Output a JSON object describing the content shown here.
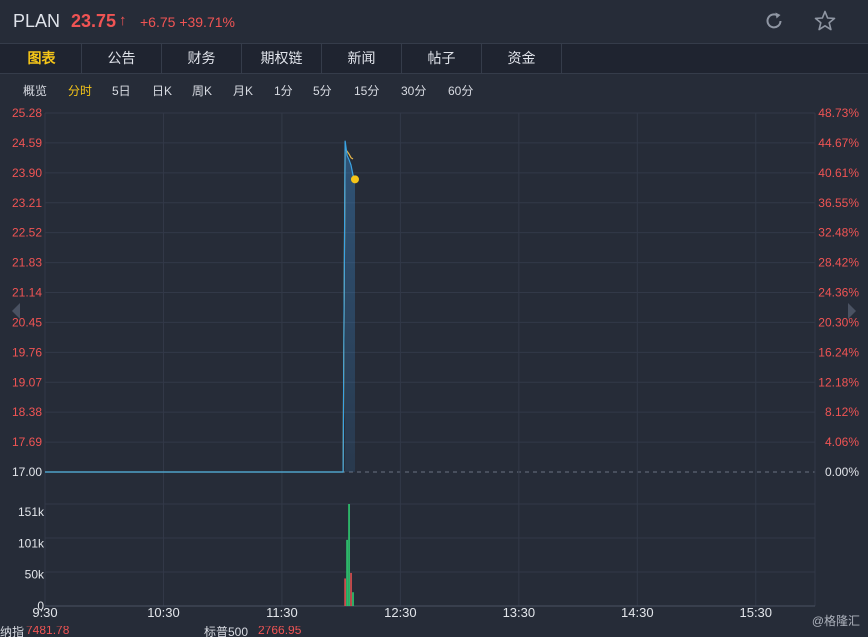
{
  "header": {
    "ticker": "PLAN",
    "price": "23.75",
    "price_arrow": "↑",
    "change": "+6.75 +39.71%",
    "refresh_icon": "refresh-icon",
    "star_icon": "star-icon"
  },
  "tabs": [
    {
      "label": "图表",
      "active": true
    },
    {
      "label": "公告"
    },
    {
      "label": "财务"
    },
    {
      "label": "期权链"
    },
    {
      "label": "新闻"
    },
    {
      "label": "帖子"
    },
    {
      "label": "资金"
    }
  ],
  "periods": [
    {
      "label": "概览"
    },
    {
      "label": "分时",
      "active": true
    },
    {
      "label": "5日"
    },
    {
      "label": "日K"
    },
    {
      "label": "周K"
    },
    {
      "label": "月K"
    },
    {
      "label": "1分"
    },
    {
      "label": "5分"
    },
    {
      "label": "15分"
    },
    {
      "label": "30分"
    },
    {
      "label": "60分"
    }
  ],
  "chart_data": {
    "type": "line",
    "base_price": 17.0,
    "price_ticks": [
      "25.28",
      "24.59",
      "23.90",
      "23.21",
      "22.52",
      "21.83",
      "21.14",
      "20.45",
      "19.76",
      "19.07",
      "18.38",
      "17.69",
      "17.00"
    ],
    "pct_ticks": [
      "48.73%",
      "44.67%",
      "40.61%",
      "36.55%",
      "32.48%",
      "28.42%",
      "24.36%",
      "20.30%",
      "16.24%",
      "12.18%",
      "8.12%",
      "4.06%",
      "0.00%"
    ],
    "ylim": [
      17.0,
      25.28
    ],
    "time_ticks": [
      "9:30",
      "10:30",
      "11:30",
      "12:30",
      "13:30",
      "14:30",
      "15:30"
    ],
    "xlim_minutes": [
      0,
      390
    ],
    "price_series": {
      "color": "#3aa3e3",
      "points": [
        [
          0,
          17.0
        ],
        [
          151,
          17.0
        ],
        [
          152,
          24.64
        ],
        [
          153,
          24.3
        ],
        [
          154,
          24.2
        ],
        [
          155,
          24.08
        ],
        [
          156,
          23.85
        ],
        [
          157,
          23.75
        ]
      ]
    },
    "avg_series": {
      "color": "#e8b84a",
      "points": [
        [
          0,
          17.0
        ],
        [
          151,
          17.0
        ],
        [
          152,
          24.45
        ],
        [
          153,
          24.4
        ],
        [
          154,
          24.33
        ],
        [
          155,
          24.25
        ],
        [
          156,
          24.22
        ]
      ]
    },
    "last_point": {
      "minute": 157,
      "price": 23.75,
      "color": "#f5c518"
    },
    "volume": {
      "ticks": [
        "151k",
        "101k",
        "50k",
        "0"
      ],
      "ylim": [
        0,
        185000
      ],
      "bars": [
        {
          "minute": 152,
          "value": 50000,
          "dir": "down"
        },
        {
          "minute": 153,
          "value": 120000,
          "dir": "up"
        },
        {
          "minute": 154,
          "value": 185000,
          "dir": "up"
        },
        {
          "minute": 155,
          "value": 60000,
          "dir": "down"
        },
        {
          "minute": 156,
          "value": 25000,
          "dir": "up"
        }
      ],
      "up_color": "#2ecc71",
      "down_color": "#e05050"
    }
  },
  "footer": {
    "index1_name": "纳指",
    "index1_value": "7481.78",
    "index2_name": "标普500",
    "index2_value": "2766.95"
  },
  "watermark": "@格隆汇"
}
